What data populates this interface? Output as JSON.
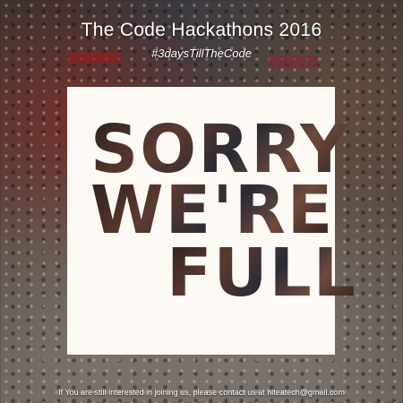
{
  "header": {
    "title": "The Code Hackathons 2016",
    "hashtag": "#3daysTillTheCode"
  },
  "card": {
    "line1": "SORRY",
    "line2": "WE'RE",
    "line3": "FULL"
  },
  "footer": {
    "text": "If You are still interested in joining us, please contact us at hiteatech@gmail.com"
  }
}
